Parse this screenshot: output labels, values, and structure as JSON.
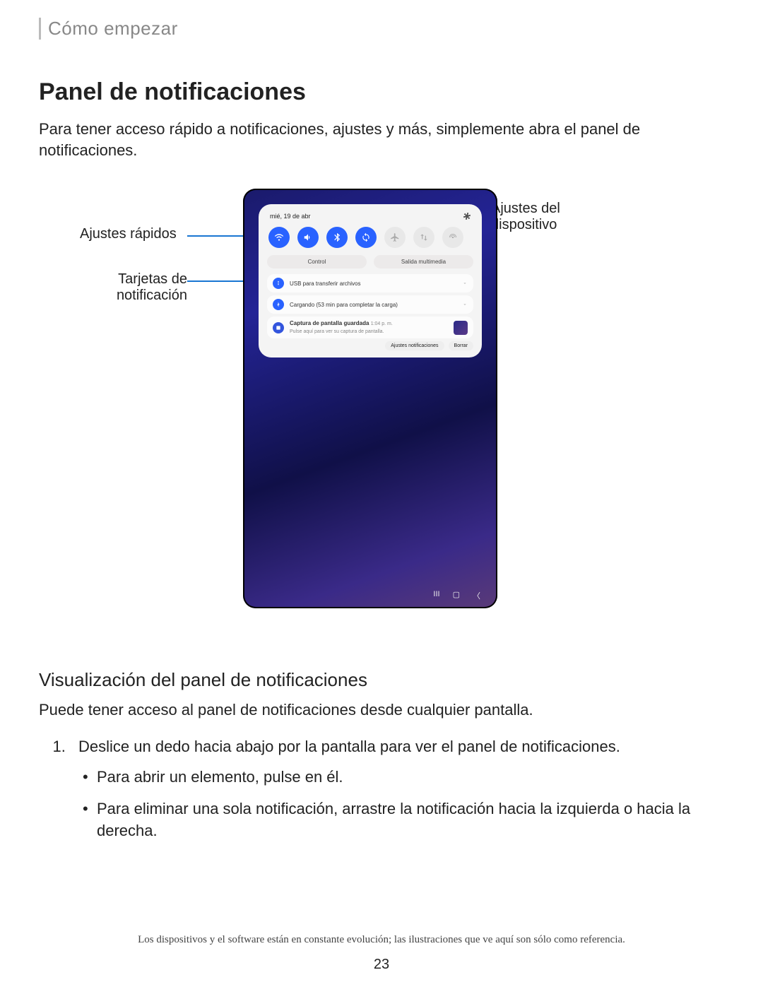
{
  "breadcrumb": "Cómo empezar",
  "title": "Panel de notificaciones",
  "intro": "Para tener acceso rápido a notificaciones, ajustes y más, simplemente abra el panel de notificaciones.",
  "callouts": {
    "quick_settings": "Ajustes rápidos",
    "notification_cards": "Tarjetas de notificación",
    "device_settings_l1": "Ajustes del",
    "device_settings_l2": "dispositivo"
  },
  "panel": {
    "date": "mié, 19 de abr",
    "pill_control": "Control",
    "pill_media": "Salida multimedia",
    "notif_usb": "USB para transferir archivos",
    "notif_charging": "Cargando (53 min para completar la carga)",
    "notif_screenshot_title": "Captura de pantalla guardada",
    "notif_screenshot_time": "1:04 p. m.",
    "notif_screenshot_sub": "Pulse aquí para ver su captura de pantalla.",
    "btn_settings": "Ajustes notificaciones",
    "btn_clear": "Borrar"
  },
  "subheading": "Visualización del panel de notificaciones",
  "body2": "Puede tener acceso al panel de notificaciones desde cualquier pantalla.",
  "step1": "Deslice un dedo hacia abajo por la pantalla para ver el panel de notificaciones.",
  "bullet1": "Para abrir un elemento, pulse en él.",
  "bullet2": "Para eliminar una sola notificación, arrastre la notificación hacia la izquierda o hacia la derecha.",
  "footnote": "Los dispositivos y el software están en constante evolución; las ilustraciones que ve aquí son sólo como referencia.",
  "pagenum": "23"
}
